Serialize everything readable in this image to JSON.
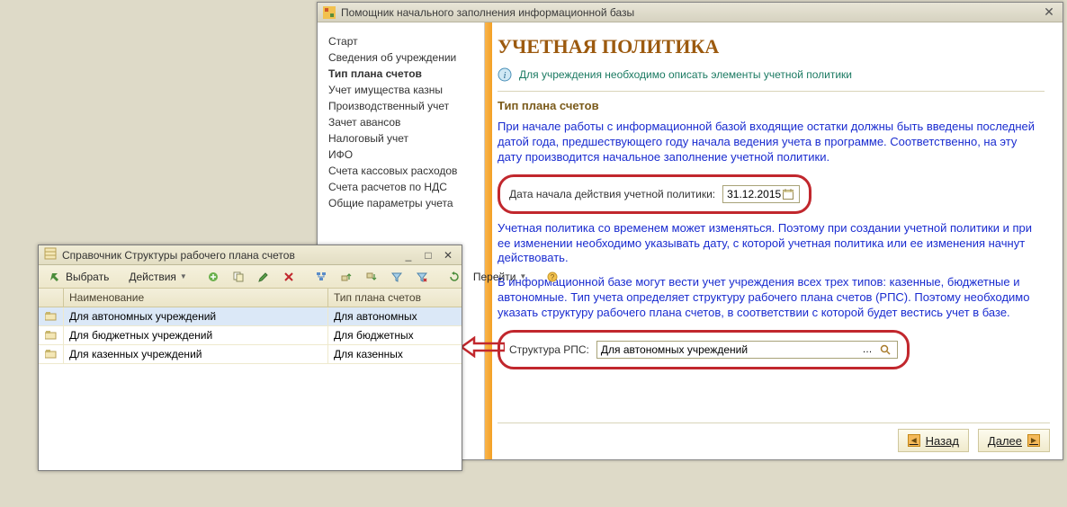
{
  "main_window": {
    "title": "Помощник начального заполнения информационной базы"
  },
  "sidebar": {
    "items": [
      {
        "label": "Старт"
      },
      {
        "label": "Сведения об учреждении"
      },
      {
        "label": "Тип плана счетов",
        "current": true
      },
      {
        "label": "Учет имущества казны"
      },
      {
        "label": "Производственный учет"
      },
      {
        "label": "Зачет авансов"
      },
      {
        "label": "Налоговый учет"
      },
      {
        "label": "ИФО"
      },
      {
        "label": "Счета кассовых расходов"
      },
      {
        "label": "Счета расчетов по НДС"
      },
      {
        "label": "Общие параметры учета"
      }
    ]
  },
  "content": {
    "title": "УЧЕТНАЯ ПОЛИТИКА",
    "info": "Для учреждения необходимо описать элементы учетной политики",
    "section": "Тип плана счетов",
    "para1": "При начале работы с информационной базой входящие остатки должны быть введены последней датой года, предшествующего году начала ведения учета в программе. Соответственно, на эту дату производится начальное заполнение учетной политики.",
    "date_label": "Дата начала действия учетной политики:",
    "date_value": "31.12.2015",
    "para2": "Учетная политика со временем может изменяться. Поэтому при создании учетной политики и при ее изменении необходимо указывать дату, с которой учетная политика или ее изменения начнут действовать.",
    "para3": "В информационной базе могут вести учет учреждения всех трех типов: казенные, бюджетные и автономные. Тип учета определяет структуру рабочего плана счетов (РПС). Поэтому необходимо указать структуру рабочего плана счетов, в соответствии с которой будет вестись учет в базе.",
    "rps_label": "Структура РПС:",
    "rps_value": "Для автономных учреждений"
  },
  "footer": {
    "back": "Назад",
    "next": "Далее"
  },
  "dialog": {
    "title": "Справочник Структуры рабочего плана счетов",
    "toolbar": {
      "select": "Выбрать",
      "actions": "Действия",
      "goto": "Перейти"
    },
    "columns": {
      "name": "Наименование",
      "type": "Тип плана счетов"
    },
    "rows": [
      {
        "name": "Для автономных учреждений",
        "type": "Для автономных",
        "selected": true
      },
      {
        "name": "Для бюджетных учреждений",
        "type": "Для бюджетных"
      },
      {
        "name": "Для казенных учреждений",
        "type": "Для казенных"
      }
    ]
  }
}
